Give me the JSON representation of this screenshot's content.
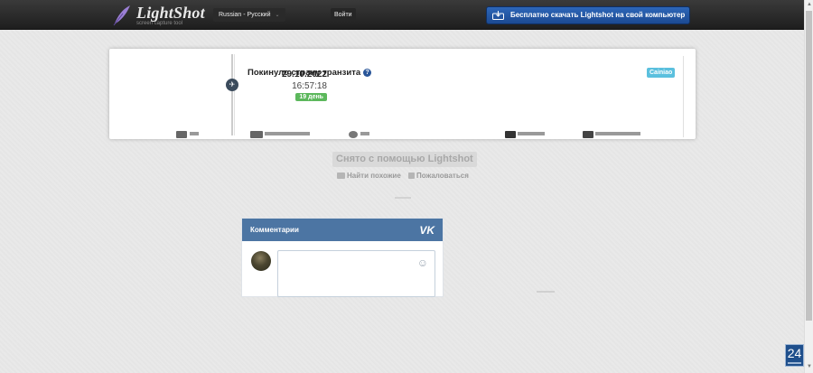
{
  "header": {
    "logo_name": "LightShot",
    "logo_tagline": "screen capture tool",
    "language": "Russian - Русский",
    "login_label": "Войти",
    "download_label": "Бесплатно скачать Lightshot на свой компьютер"
  },
  "screenshot": {
    "event": {
      "date": "29.10.2022",
      "time": "16:57:18",
      "days_badge": "19 день",
      "status": "Покинуло страну транзита",
      "carrier": "Cainiao"
    }
  },
  "info": {
    "taken_with": "Снято с помощью Lightshot",
    "find_similar": "Найти похожие",
    "report": "Пожаловаться"
  },
  "comments": {
    "title": "Комментарии",
    "vk_label": "VK"
  },
  "corner_badge": "24",
  "colors": {
    "accent_blue": "#2c66b8",
    "vk_blue": "#4c75a3",
    "badge_green": "#5cb85c",
    "carrier_badge": "#5bc0de"
  }
}
